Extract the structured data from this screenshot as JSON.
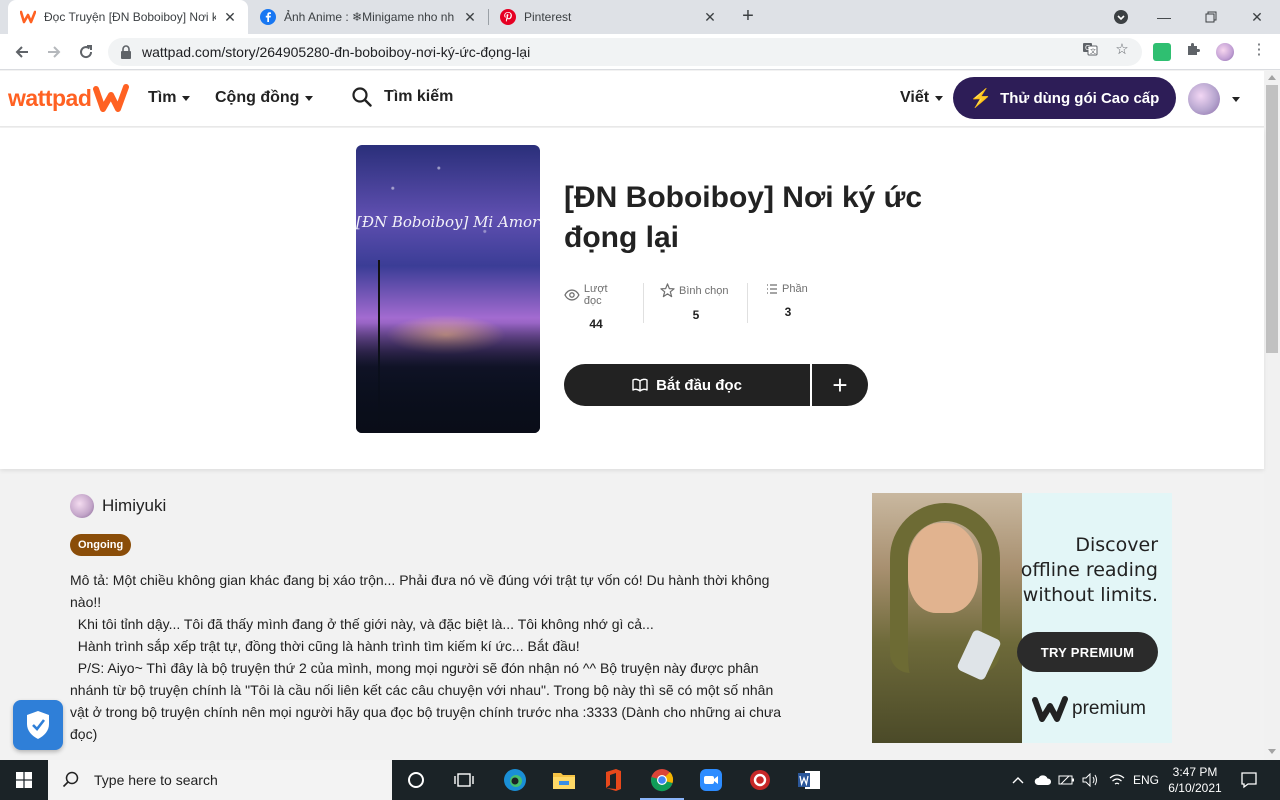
{
  "browser": {
    "tabs": [
      {
        "label": "Đọc Truyện [ĐN Boboiboy] Nơi k",
        "active": true
      },
      {
        "label": "Ảnh Anime : ❄Minigame nho nh",
        "active": false
      },
      {
        "label": "Pinterest",
        "active": false
      }
    ],
    "url": "wattpad.com/story/264905280-đn-boboiboy-nơi-ký-ức-đọng-lại"
  },
  "header": {
    "logo_text": "wattpad",
    "nav_find": "Tìm",
    "nav_community": "Cộng đồng",
    "search_label": "Tìm kiếm",
    "write_label": "Viết",
    "premium_label": "Thử dùng gói Cao cấp"
  },
  "story": {
    "cover_text": "[ĐN Boboiboy] Mi Amore",
    "title": "[ĐN Boboiboy] Nơi ký ức đọng lại",
    "stats": [
      {
        "label": "Lượt đọc",
        "value": "44",
        "icon": "eye-icon"
      },
      {
        "label": "Bình chọn",
        "value": "5",
        "icon": "star-icon"
      },
      {
        "label": "Phần",
        "value": "3",
        "icon": "list-icon"
      }
    ],
    "start_reading": "Bắt đầu đọc",
    "add_symbol": "+"
  },
  "details": {
    "author": "Himiyuki",
    "status": "Ongoing",
    "description": [
      "Mô tả: Một chiều không gian khác đang bị xáo trộn... Phải đưa nó về đúng với trật tự vốn có! Du hành thời không nào!!",
      "  Khi tôi tỉnh dậy... Tôi đã thấy mình đang ở thế giới này, và đặc biệt là... Tôi không nhớ gì cả...",
      "  Hành trình sắp xếp trật tự, đồng thời cũng là hành trình tìm kiếm kí ức... Bắt đầu!",
      "  P/S: Aiyo~ Thì đây là bộ truyện thứ 2 của mình, mong mọi người sẽ đón nhận nó ^^ Bộ truyện này được phân nhánh từ bộ truyện chính là \"Tôi là cầu nối liên kết các câu chuyện với nhau\". Trong bộ này thì sẽ có một số nhân vật ở trong bộ truyện chính nên mọi người hãy qua đọc bộ truyện chính trước nha :3333 (Dành cho những ai chưa đọc)"
    ]
  },
  "ad": {
    "headline": "Discover offline reading without limits.",
    "cta": "TRY PREMIUM",
    "brand": "premium"
  },
  "taskbar": {
    "search_placeholder": "Type here to search",
    "language": "ENG",
    "time": "3:47 PM",
    "date": "6/10/2021"
  },
  "colors": {
    "wattpad_orange": "#ff6122",
    "premium_purple": "#2d1d57",
    "status_brown": "#8a4d09"
  }
}
